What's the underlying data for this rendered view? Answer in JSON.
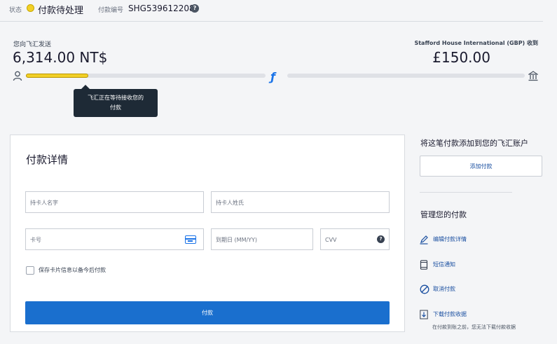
{
  "status": {
    "label": "状态",
    "value": "付款待处理",
    "color": "#f2d027",
    "payment_id_label": "付款编号",
    "payment_id": "SHG539612208"
  },
  "transfer": {
    "send_label": "您向飞汇发送",
    "send_amount": "6,314.00 NT$",
    "receive_label": "Stafford House International (GBP) 收到",
    "receive_amount": "£150.00",
    "progress": 0.26,
    "tooltip_line1": "飞汇正在等待接收您的",
    "tooltip_line2": "付款"
  },
  "payment_form": {
    "title": "付款详情",
    "first_name_placeholder": "持卡人名字",
    "last_name_placeholder": "持卡人姓氏",
    "card_number_placeholder": "卡号",
    "expiry_placeholder": "到期日 (MM/YY)",
    "cvv_placeholder": "CVV",
    "save_card_label": "保存卡片信息以备今后付款",
    "pay_button": "付款",
    "accent": "#1a6fce"
  },
  "sidebar": {
    "add_title": "将这笔付款添加到您的飞汇账户",
    "add_button": "添加付款",
    "manage_title": "管理您的付款",
    "actions": [
      {
        "label": "编辑付款详情",
        "icon": "pencil-icon"
      },
      {
        "label": "短信通知",
        "icon": "phone-icon"
      },
      {
        "label": "取消付款",
        "icon": "cancel-icon"
      },
      {
        "label": "下载付款收据",
        "icon": "download-icon"
      }
    ],
    "download_note": "在付款到账之前，您无法下载付款收据"
  }
}
